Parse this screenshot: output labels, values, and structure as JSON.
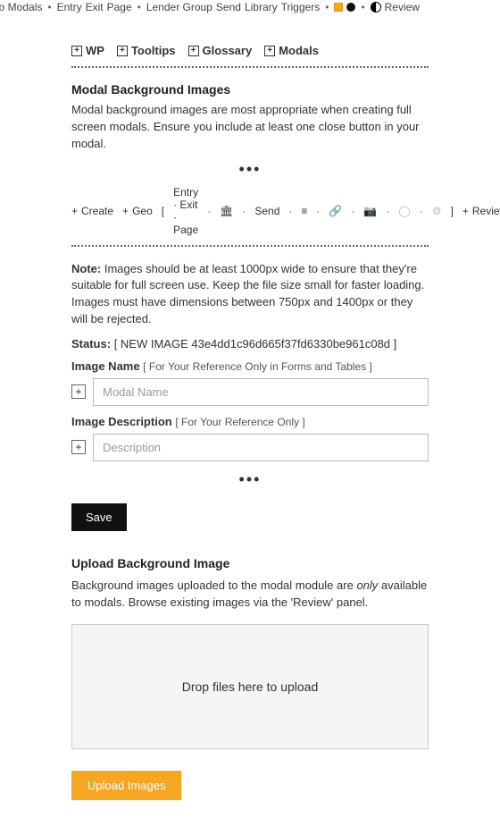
{
  "topnav": {
    "items": [
      "eo Modals",
      "Entry",
      "Exit",
      "Page",
      "Lender Group",
      "Send",
      "Library",
      "Triggers"
    ],
    "review": "Review"
  },
  "tabs": {
    "wp": "WP",
    "tooltips": "Tooltips",
    "glossary": "Glossary",
    "modals": "Modals"
  },
  "hero": {
    "title": "Modal Background Images",
    "desc": "Modal background images are most appropriate when creating full screen modals. Ensure you include at least one close button in your modal."
  },
  "createrow": {
    "create": "Create",
    "geo": "Geo",
    "list": "Entry · Exit · Page",
    "send": "Send",
    "review": "Review"
  },
  "note": {
    "label": "Note:",
    "text": " Images should be at least 1000px wide to ensure that they're suitable for full screen use. Keep the file size small for faster loading. Images must have dimensions between 750px and 1400px or they will be rejected."
  },
  "status": {
    "label": "Status:",
    "value": "NEW IMAGE 43e4dd1c96d665f37fd6330be961c08d"
  },
  "name_field": {
    "label": "Image Name",
    "hint": "For Your Reference Only in Forms and Tables",
    "placeholder": "Modal Name"
  },
  "desc_field": {
    "label": "Image Description",
    "hint": "For Your Reference Only",
    "placeholder": "Description"
  },
  "buttons": {
    "save": "Save",
    "upload": "Upload Images"
  },
  "upload": {
    "title": "Upload Background Image",
    "desc_a": "Background images uploaded to the modal module are ",
    "desc_em": "only",
    "desc_b": " available to modals. Browse existing images via the 'Review' panel.",
    "drop": "Drop files here to upload"
  }
}
